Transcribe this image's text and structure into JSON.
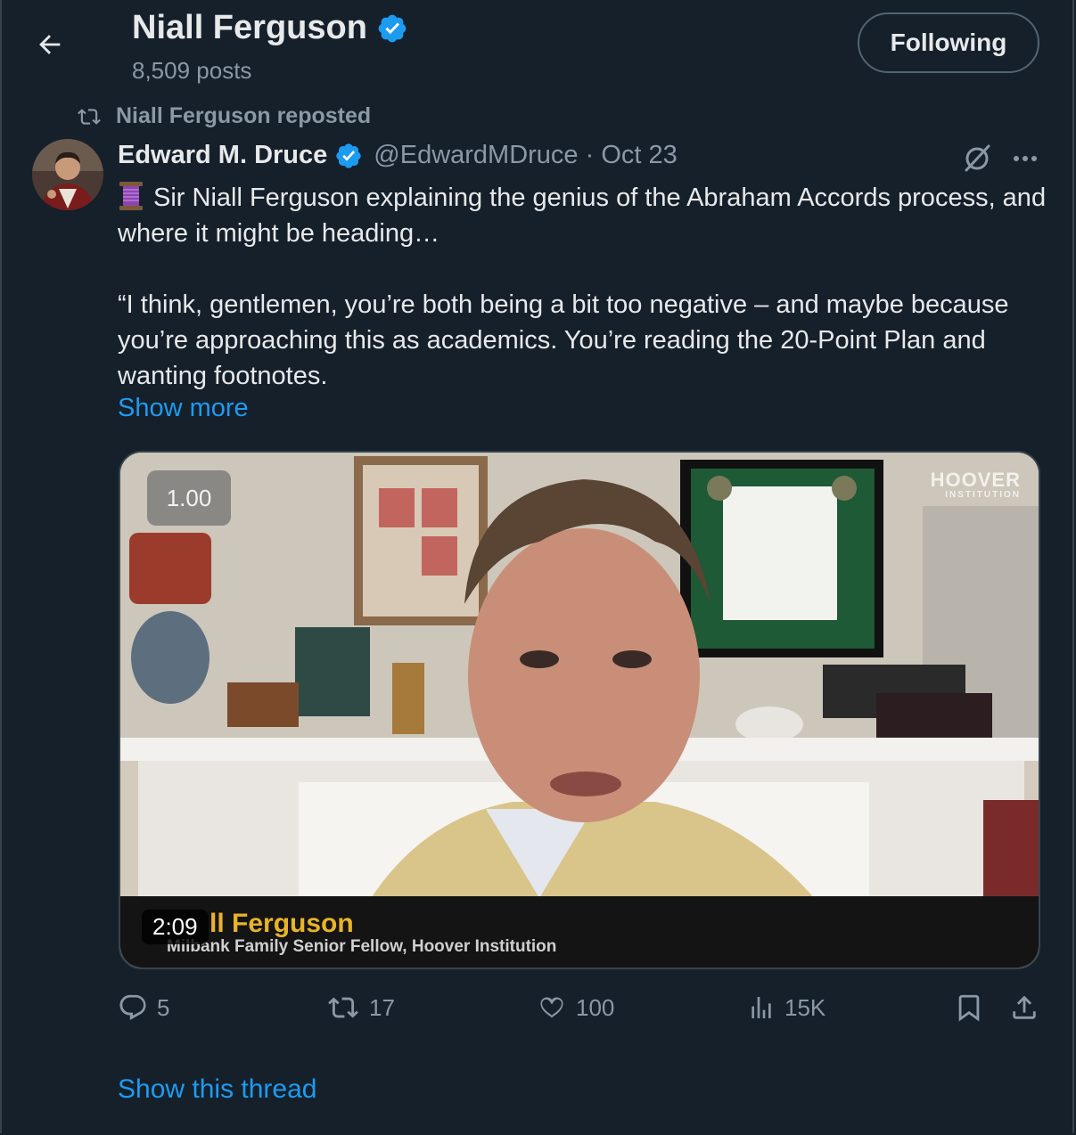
{
  "header": {
    "profile_name": "Niall Ferguson",
    "post_count": "8,509 posts",
    "follow_label": "Following"
  },
  "tweet": {
    "repost_label": "Niall Ferguson reposted",
    "author_name": "Edward M. Druce",
    "author_meta": "@EdwardMDruce · Oct 23",
    "text_line1": "Sir Niall Ferguson explaining the genius of the Abraham Accords process, and where it might be heading…",
    "text_para2": "“I think, gentlemen, you’re both being a bit too negative – and maybe because you’re approaching this as academics. You’re reading the 20-Point Plan and wanting footnotes.",
    "show_more": "Show more",
    "video": {
      "speed_label": "1.00",
      "duration": "2:09",
      "watermark_line1": "HOOVER",
      "watermark_line2": "INSTITUTION",
      "caption_name": "ll Ferguson",
      "caption_title": "Milbank Family Senior Fellow, Hoover Institution"
    },
    "actions": {
      "replies": "5",
      "reposts": "17",
      "likes": "100",
      "views": "15K"
    },
    "show_thread": "Show this thread"
  },
  "colors": {
    "background": "#15202b",
    "accent": "#1d9bf0",
    "verified": "#1d9bf0",
    "muted_text": "#8b98a5"
  },
  "icons": [
    "back-arrow-icon",
    "verified-badge-icon",
    "repost-icon",
    "grok-icon",
    "more-icon",
    "spool-emoji-icon",
    "reply-icon",
    "like-icon",
    "views-icon",
    "bookmark-icon",
    "share-icon"
  ]
}
